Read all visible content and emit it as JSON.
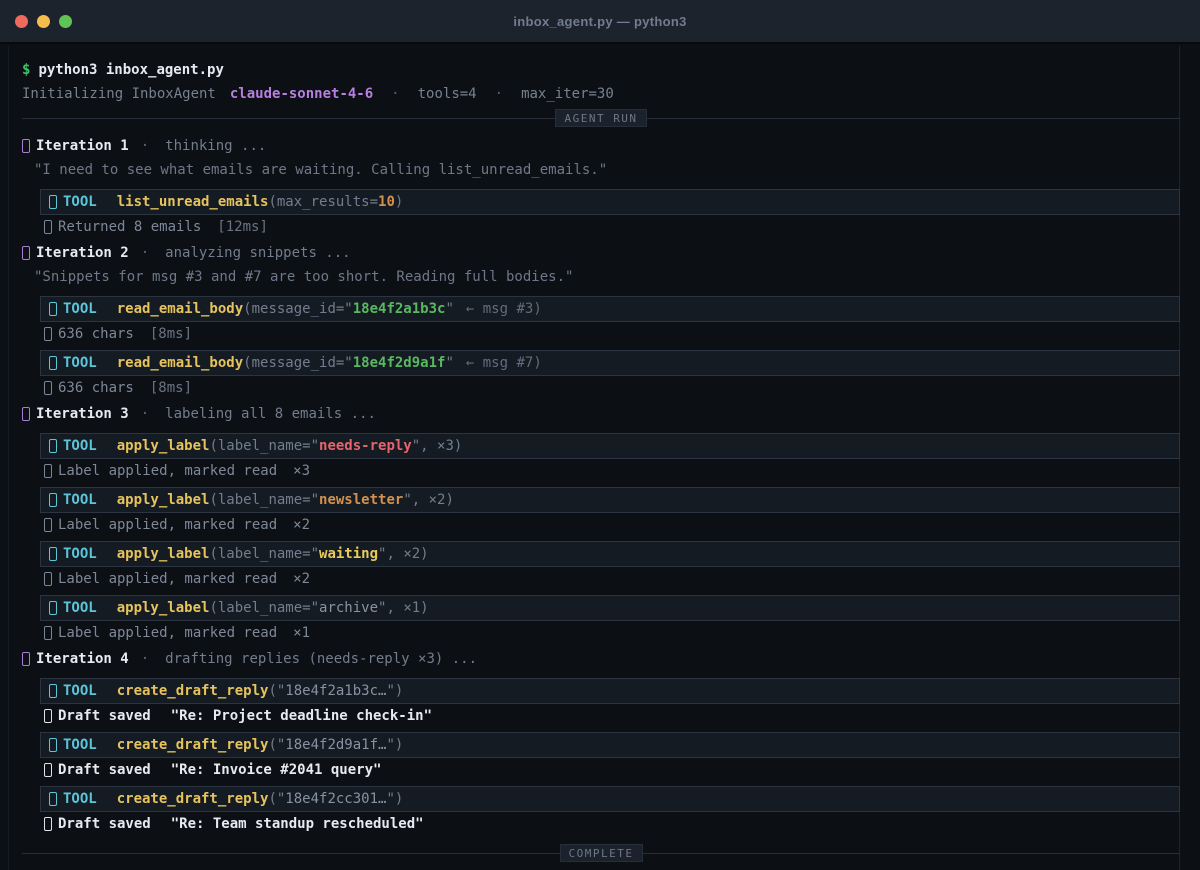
{
  "window": {
    "title": "inbox_agent.py — python3"
  },
  "shell": {
    "prompt": "$",
    "command": "python3 inbox_agent.py"
  },
  "init": {
    "text": "Initializing InboxAgent",
    "model": "claude-sonnet-4-6",
    "sep": "·",
    "tools": "tools=4",
    "max_iter": "max_iter=30"
  },
  "banners": {
    "start": "AGENT RUN",
    "end": "COMPLETE"
  },
  "tool_badge": "TOOL",
  "colors": {
    "background": "#0c0f14",
    "titlebar": "#1d232c",
    "tool_cyan": "#5bc6da",
    "fn_yellow": "#e6c35c",
    "num_orange": "#d2914f",
    "label_red": "#e5646d",
    "id_green": "#59b860",
    "model_purple": "#b77fe0",
    "prompt_green": "#3fc46a",
    "text_gray": "#818b9b",
    "text_white": "#e7eaf0"
  },
  "iterations": [
    {
      "label": "Iteration 1",
      "sep": "·",
      "status": "thinking ...",
      "quote": "\"I need to see what emails are waiting. Calling list_unread_emails.\"",
      "calls": [
        {
          "fn": "list_unread_emails",
          "pre": "(max_results=",
          "val": "10",
          "post": ")",
          "result": {
            "text": "Returned 8 emails",
            "time": "[12ms]"
          }
        }
      ]
    },
    {
      "label": "Iteration 2",
      "sep": "·",
      "status": "analyzing snippets ...",
      "quote": "\"Snippets for msg #3 and #7 are too short. Reading full bodies.\"",
      "calls": [
        {
          "fn": "read_email_body",
          "pre": "(message_id=\"",
          "val": "18e4f2a1b3c",
          "post": "\"",
          "note": "← msg #3)",
          "result": {
            "text": "636 chars",
            "time": "[8ms]"
          }
        },
        {
          "fn": "read_email_body",
          "pre": "(message_id=\"",
          "val": "18e4f2d9a1f",
          "post": "\"",
          "note": "← msg #7)",
          "result": {
            "text": "636 chars",
            "time": "[8ms]"
          }
        }
      ]
    },
    {
      "label": "Iteration 3",
      "sep": "·",
      "status": "labeling all 8 emails ...",
      "calls": [
        {
          "fn": "apply_label",
          "pre": "(label_name=\"",
          "val": "needs-reply",
          "post": "\", ×3)",
          "result": {
            "text": "Label applied, marked read",
            "count": "×3"
          }
        },
        {
          "fn": "apply_label",
          "pre": "(label_name=\"",
          "val": "newsletter",
          "post": "\", ×2)",
          "result": {
            "text": "Label applied, marked read",
            "count": "×2"
          }
        },
        {
          "fn": "apply_label",
          "pre": "(label_name=\"",
          "val": "waiting",
          "post": "\", ×2)",
          "result": {
            "text": "Label applied, marked read",
            "count": "×2"
          }
        },
        {
          "fn": "apply_label",
          "pre": "(label_name=\"",
          "val": "archive",
          "post": "\", ×1)",
          "result": {
            "text": "Label applied, marked read",
            "count": "×1"
          }
        }
      ]
    },
    {
      "label": "Iteration 4",
      "sep": "·",
      "status": "drafting replies (needs-reply ×3) ...",
      "calls": [
        {
          "fn": "create_draft_reply",
          "pre": "(\"",
          "val": "18e4f2a1b3c…",
          "post": "\")",
          "result": {
            "label": "Draft saved",
            "subject": "\"Re: Project deadline check-in\""
          }
        },
        {
          "fn": "create_draft_reply",
          "pre": "(\"",
          "val": "18e4f2d9a1f…",
          "post": "\")",
          "result": {
            "label": "Draft saved",
            "subject": "\"Re: Invoice #2041 query\""
          }
        },
        {
          "fn": "create_draft_reply",
          "pre": "(\"",
          "val": "18e4f2cc301…",
          "post": "\")",
          "result": {
            "label": "Draft saved",
            "subject": "\"Re: Team standup rescheduled\""
          }
        }
      ]
    }
  ]
}
